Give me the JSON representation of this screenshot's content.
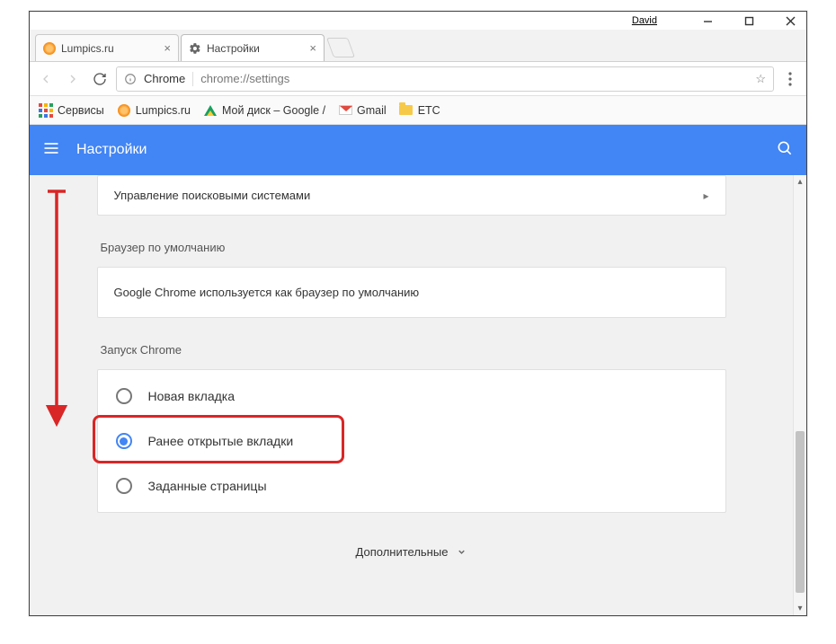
{
  "window": {
    "user_label": "David"
  },
  "tabs": [
    {
      "title": "Lumpics.ru",
      "active": false
    },
    {
      "title": "Настройки",
      "active": true
    }
  ],
  "address_bar": {
    "origin_label": "Chrome",
    "url_path": "chrome://settings"
  },
  "bookmarks": {
    "apps_label": "Сервисы",
    "items": [
      {
        "label": "Lumpics.ru",
        "icon": "lumpics"
      },
      {
        "label": "Мой диск – Google /",
        "icon": "gdrive"
      },
      {
        "label": "Gmail",
        "icon": "gmail"
      },
      {
        "label": "ETC",
        "icon": "folder"
      }
    ]
  },
  "header": {
    "title": "Настройки"
  },
  "settings": {
    "search_engines_row": "Управление поисковыми системами",
    "default_browser_section_title": "Браузер по умолчанию",
    "default_browser_info": "Google Chrome используется как браузер по умолчанию",
    "onstartup_section_title": "Запуск Chrome",
    "onstartup_options": [
      {
        "label": "Новая вкладка",
        "selected": false
      },
      {
        "label": "Ранее открытые вкладки",
        "selected": true
      },
      {
        "label": "Заданные страницы",
        "selected": false
      }
    ],
    "advanced_label": "Дополнительные"
  }
}
